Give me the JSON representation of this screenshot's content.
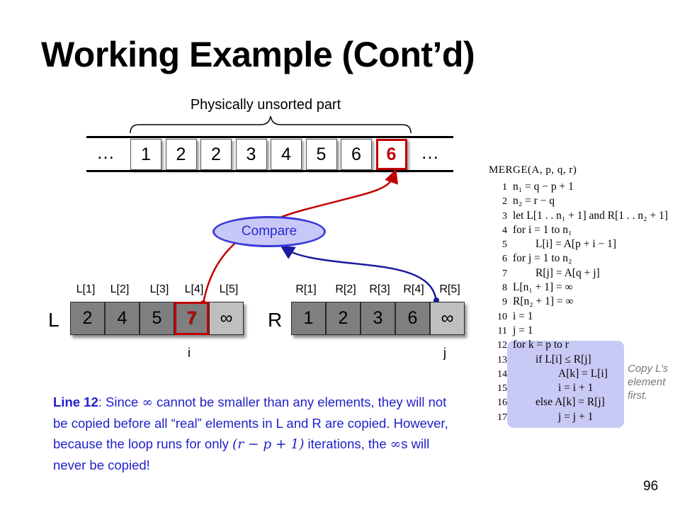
{
  "title": "Working Example (Cont’d)",
  "brace_label": "Physically unsorted part",
  "array": {
    "ellipsis": "…",
    "cells": [
      "1",
      "2",
      "2",
      "3",
      "4",
      "5",
      "6",
      "6"
    ],
    "highlight_index": 7
  },
  "compare_label": "Compare",
  "L": {
    "name": "L",
    "index_labels": [
      "L[1]",
      "L[2]",
      "L[3]",
      "L[4]",
      "L[5]"
    ],
    "cells": [
      "2",
      "4",
      "5",
      "7",
      "∞"
    ],
    "pointer": "i",
    "highlight_index": 3
  },
  "R": {
    "name": "R",
    "index_labels": [
      "R[1]",
      "R[2]",
      "R[3]",
      "R[4]",
      "R[5]"
    ],
    "cells": [
      "1",
      "2",
      "3",
      "6",
      "∞"
    ],
    "pointer": "j"
  },
  "paragraph": {
    "lead": "Line 12",
    "t1": ": Since ",
    "inf": "∞",
    "t2": " cannot be smaller than any elements, they will not be copied before all “real” elements in L and R are copied. However, because the loop runs for only ",
    "math": "(r − p + 1)",
    "t3": " iterations, the ",
    "inf2": "∞",
    "t4": "s will never be copied!"
  },
  "code": {
    "header": "MERGE(A, p, q, r)",
    "lines": [
      {
        "n": "1",
        "t": "n₁ = q − p + 1",
        "indent": 0
      },
      {
        "n": "2",
        "t": "n₂ = r − q",
        "indent": 0
      },
      {
        "n": "3",
        "t": "let L[1 . . n₁ + 1] and R[1 . . n₂ + 1]",
        "indent": 0
      },
      {
        "n": "4",
        "t": "for i = 1 to n₁",
        "indent": 0
      },
      {
        "n": "5",
        "t": "L[i] = A[p + i − 1]",
        "indent": 1
      },
      {
        "n": "6",
        "t": "for j = 1 to n₂",
        "indent": 0
      },
      {
        "n": "7",
        "t": "R[j] = A[q + j]",
        "indent": 1
      },
      {
        "n": "8",
        "t": "L[n₁ + 1] = ∞",
        "indent": 0
      },
      {
        "n": "9",
        "t": "R[n₂ + 1] = ∞",
        "indent": 0
      },
      {
        "n": "10",
        "t": "i = 1",
        "indent": 0
      },
      {
        "n": "11",
        "t": "j = 1",
        "indent": 0
      },
      {
        "n": "12",
        "t": "for k = p to r",
        "indent": 0
      },
      {
        "n": "13",
        "t": "if L[i] ≤ R[j]",
        "indent": 1
      },
      {
        "n": "14",
        "t": "A[k] = L[i]",
        "indent": 2
      },
      {
        "n": "15",
        "t": "i = i + 1",
        "indent": 2
      },
      {
        "n": "16",
        "t": "else A[k] = R[j]",
        "indent": 1
      },
      {
        "n": "17",
        "t": "j = j + 1",
        "indent": 2
      }
    ]
  },
  "side_note": [
    "Copy L’s",
    "element",
    "first."
  ],
  "page_number": "96",
  "colors": {
    "highlight": "#c00000",
    "compare_fill": "#c8c8f8",
    "compare_stroke": "#3a3ad6",
    "code_highlight": "#c9c9f6",
    "text_blue": "#1f1fc8"
  }
}
